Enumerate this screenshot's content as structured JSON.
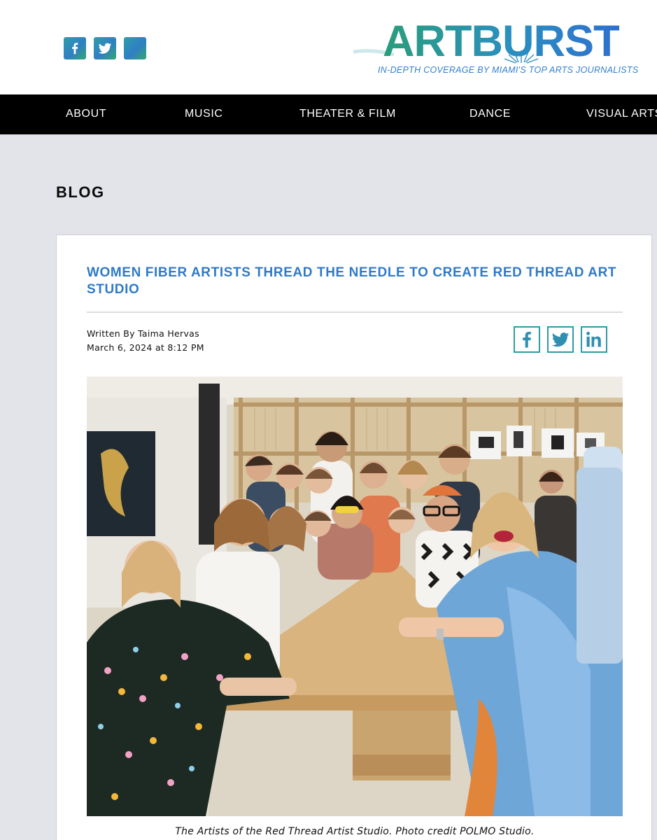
{
  "header": {
    "social": [
      {
        "name": "facebook",
        "icon": "facebook-icon"
      },
      {
        "name": "twitter",
        "icon": "twitter-icon"
      },
      {
        "name": "instagram",
        "icon": "instagram-icon"
      }
    ],
    "logo": {
      "wordmark": "ARTBURST",
      "tagline": "IN-DEPTH COVERAGE BY MIAMI'S TOP ARTS JOURNALISTS"
    },
    "colors": {
      "brand_blue": "#2f7ac8",
      "brand_teal": "#2a9d7a",
      "nav_bg": "#000000",
      "page_bg": "#e3e4ea"
    }
  },
  "nav": {
    "items": [
      "ABOUT",
      "MUSIC",
      "THEATER & FILM",
      "DANCE",
      "VISUAL ARTS"
    ]
  },
  "page": {
    "section_heading": "BLOG"
  },
  "article": {
    "title": "WOMEN FIBER ARTISTS THREAD THE NEEDLE TO CREATE RED THREAD ART STUDIO",
    "author_line": "Written By Taima Hervas",
    "date_line": "March 6, 2024 at 8:12 PM",
    "share": [
      {
        "name": "facebook",
        "icon": "facebook-icon"
      },
      {
        "name": "twitter",
        "icon": "twitter-icon"
      },
      {
        "name": "linkedin",
        "icon": "linkedin-icon"
      }
    ],
    "photo_caption": "The Artists of the Red Thread Artist Studio. Photo credit POLMO Studio."
  }
}
